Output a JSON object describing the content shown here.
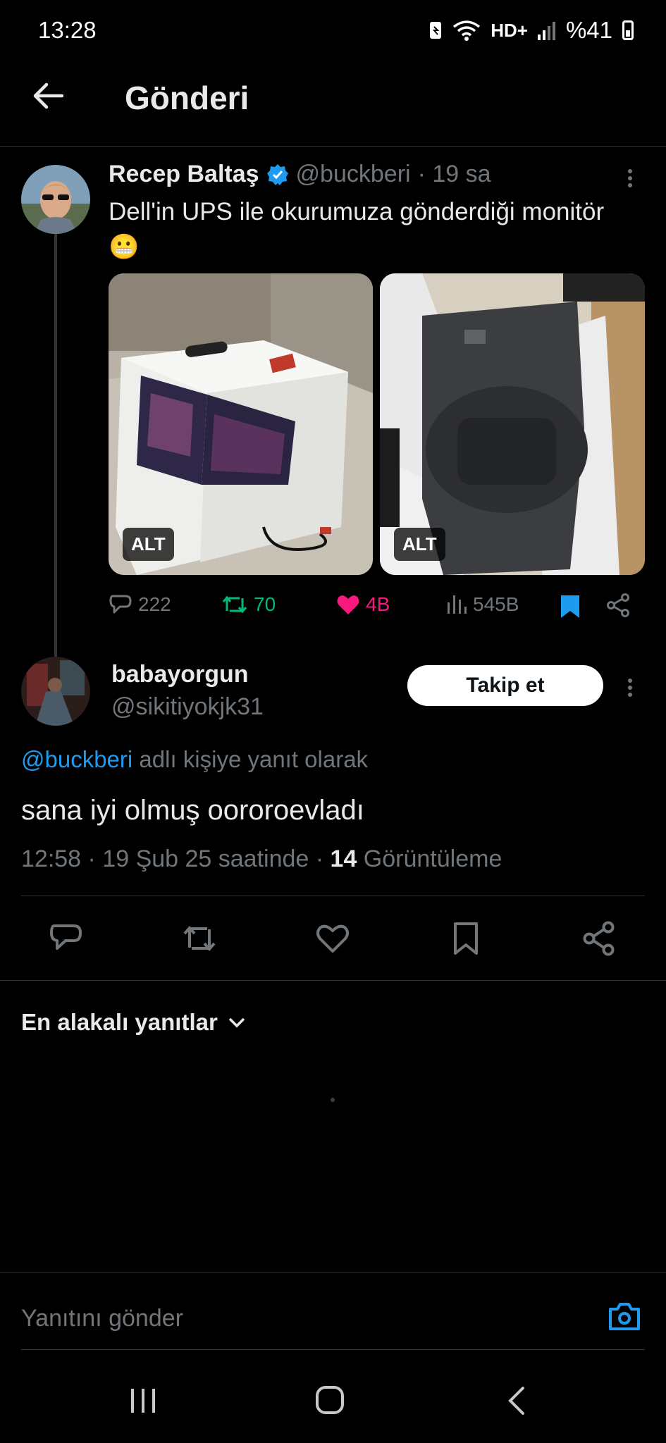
{
  "status_bar": {
    "time": "13:28",
    "network": "HD+",
    "battery": "%41"
  },
  "header": {
    "title": "Gönderi"
  },
  "original_post": {
    "author_name": "Recep Baltaş",
    "author_handle": "@buckberi",
    "time_ago": "· 19 sa",
    "text": "Dell'in UPS ile okurumuza gönderdiği monitör",
    "emoji": "😬",
    "media": [
      {
        "alt_label": "ALT"
      },
      {
        "alt_label": "ALT"
      }
    ],
    "stats": {
      "replies": "222",
      "reposts": "70",
      "likes": "4B",
      "views": "545B"
    },
    "colors": {
      "verified": "#1d9bf0",
      "repost": "#00ba7c",
      "like": "#f91880",
      "bookmark": "#1d9bf0"
    }
  },
  "reply_post": {
    "author_name": "babayorgun",
    "author_handle": "@sikitiyokjk31",
    "follow_label": "Takip et",
    "reply_to_mention": "@buckberi",
    "reply_to_suffix": " adlı kişiye yanıt olarak",
    "text": "sana iyi olmuş oororoevladı",
    "timestamp": "12:58 · 19 Şub 25 saatinde · ",
    "views_count": "14",
    "views_label": " Görüntüleme"
  },
  "sort": {
    "label": "En alakalı yanıtlar"
  },
  "composer": {
    "placeholder": "Yanıtını gönder"
  },
  "icons": [
    "back-arrow-icon",
    "verified-icon",
    "more-icon",
    "reply-icon",
    "repost-icon",
    "like-icon",
    "views-icon",
    "bookmark-icon",
    "share-icon",
    "chevron-down-icon",
    "camera-icon",
    "recents-icon",
    "home-icon",
    "back-icon"
  ]
}
